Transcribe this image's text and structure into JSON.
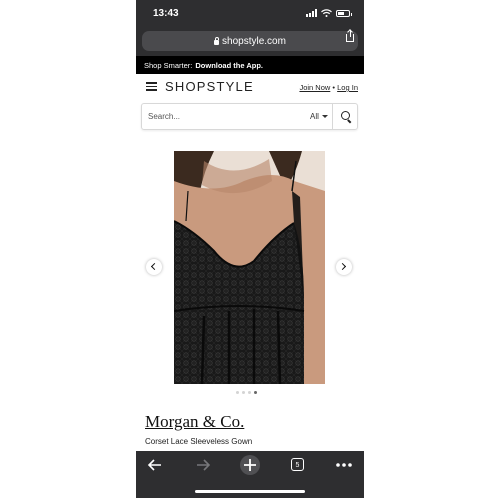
{
  "status_bar": {
    "time": "13:43"
  },
  "browser": {
    "url": "shopstyle.com",
    "tab_count": "5"
  },
  "promo": {
    "text": "Shop Smarter:",
    "link": "Download the App."
  },
  "header": {
    "logo": "SHOPSTYLE",
    "join": "Join Now",
    "separator": "•",
    "login": "Log In"
  },
  "search": {
    "placeholder": "Search...",
    "category": "All"
  },
  "product": {
    "brand": "Morgan & Co.",
    "name": "Corset Lace Sleeveless Gown",
    "image_count": 4,
    "active_image": 4
  },
  "icons": {
    "menu": "hamburger-icon",
    "search": "magnifier-icon",
    "lock": "lock-icon",
    "share": "share-icon",
    "back": "back-arrow-icon",
    "forward": "forward-arrow-icon",
    "new_tab": "plus-icon",
    "tabs": "tabs-icon",
    "more": "more-dots-icon"
  },
  "colors": {
    "browser_chrome": "#2e2e30",
    "promo_bg": "#000000",
    "text": "#222222"
  }
}
